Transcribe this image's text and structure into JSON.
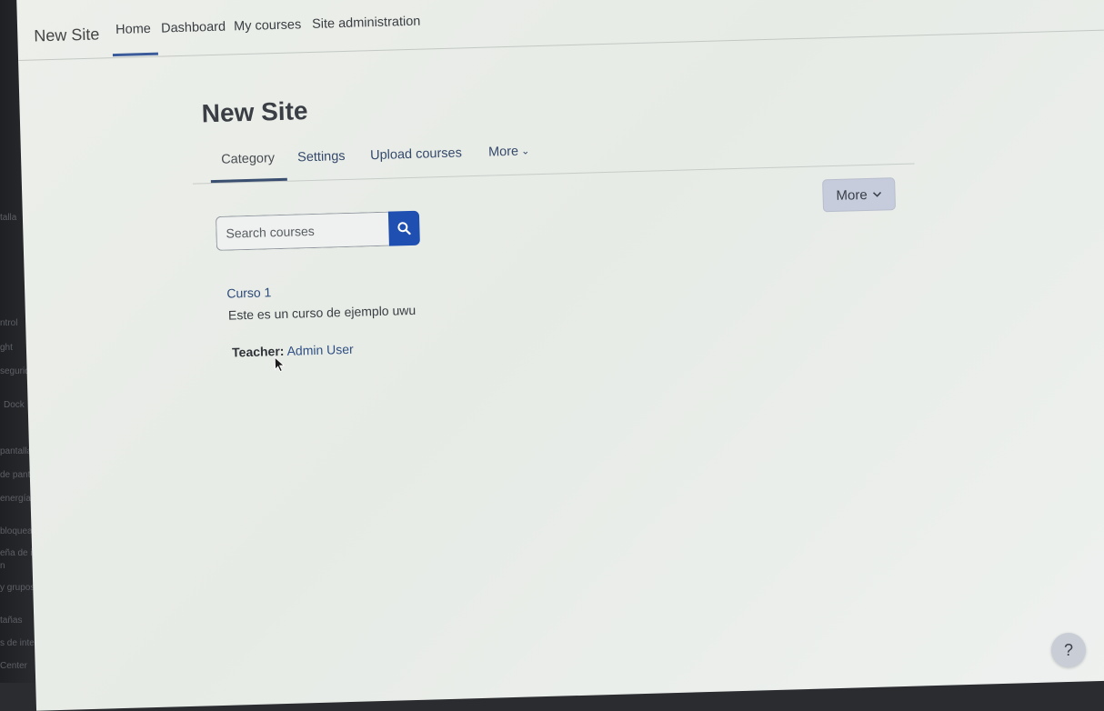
{
  "backdrop": {
    "items": [
      "talla",
      "ntrol",
      "ght",
      "segurid",
      "Dock",
      "pantalla",
      "de pantal",
      "energía",
      "bloqueada",
      "eña de inicio",
      "n",
      "y grupos",
      "tañas",
      "s de internet",
      "Center"
    ]
  },
  "navbar": {
    "brand": "New Site",
    "links": [
      "Home",
      "Dashboard",
      "My courses",
      "Site administration"
    ]
  },
  "page": {
    "title": "New Site",
    "tabs": [
      "Category",
      "Settings",
      "Upload courses",
      "More"
    ],
    "more_button": "More"
  },
  "search": {
    "placeholder": "Search courses",
    "icon": "search-icon"
  },
  "course": {
    "name": "Curso 1",
    "summary": "Este es un curso de ejemplo uwu",
    "teacher_label": "Teacher:",
    "teacher_name": "Admin User"
  },
  "help": {
    "label": "?"
  },
  "colors": {
    "primary": "#1f4fb0",
    "link": "#2f4f82",
    "background": "#eceee9"
  }
}
